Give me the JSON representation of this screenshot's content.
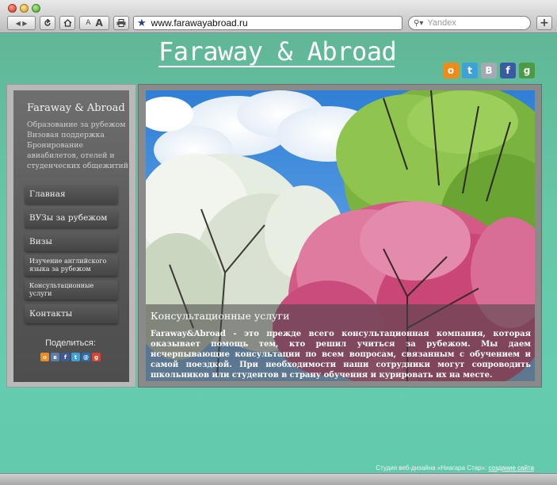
{
  "browser": {
    "url": "www.farawayabroad.ru",
    "search_placeholder": "Yandex",
    "back_forward": "◀ ▶",
    "reload_icon": "reload-icon",
    "home_icon": "home-icon",
    "font_small": "A",
    "font_large": "A",
    "add_tab": "+"
  },
  "site": {
    "title": "Faraway & Abroad"
  },
  "social_top": [
    {
      "icon": "odnoklassniki-icon",
      "glyph": "о",
      "color": "#f08a19"
    },
    {
      "icon": "twitter-icon",
      "glyph": "t",
      "color": "#3fa1d6"
    },
    {
      "icon": "vkontakte-icon",
      "glyph": "В",
      "color": "#a4a9b3"
    },
    {
      "icon": "facebook-icon",
      "glyph": "f",
      "color": "#3b5ba0"
    },
    {
      "icon": "google-icon",
      "glyph": "g",
      "color": "#4c9a45"
    }
  ],
  "sidebar": {
    "brand": "Faraway & Abroad",
    "desc_lines": [
      "Образование за рубежом",
      "Визовая поддержка",
      "Бронирование",
      "авиабилетов, отелей и",
      "студенческих общежитий"
    ],
    "nav": [
      {
        "label": "Главная"
      },
      {
        "label": "ВУЗы за рубежом"
      },
      {
        "label": "Визы"
      },
      {
        "label": "Изучение английского языка за рубежом"
      },
      {
        "label": "Консультационные услуги"
      },
      {
        "label": "Контакты"
      }
    ],
    "share_label": "Поделиться:"
  },
  "social_small": [
    {
      "icon": "odnoklassniki-icon",
      "glyph": "о",
      "color": "#f08a19"
    },
    {
      "icon": "vkontakte-icon",
      "glyph": "в",
      "color": "#5a7fa8"
    },
    {
      "icon": "facebook-icon",
      "glyph": "f",
      "color": "#3b5ba0"
    },
    {
      "icon": "twitter-icon",
      "glyph": "t",
      "color": "#3fa1d6"
    },
    {
      "icon": "mail-icon",
      "glyph": "@",
      "color": "#2a6db5"
    },
    {
      "icon": "google-plus-icon",
      "glyph": "g",
      "color": "#d6452f"
    }
  ],
  "main": {
    "caption_title": "Консультационные услуги",
    "caption_text": "Faraway&Abroad - это прежде всего консультационная компания, которая оказывает помощь тем, кто решил учиться за рубежом. Мы даем исчерпывающие консультации по всем вопросам, связанным с обучением и самой поездкой. При необходимости наши сотрудники могут сопроводить школьников или студентов в страну обучения и курировать их на месте."
  },
  "footer": {
    "text": "Студия веб-дизайна «Ниагара Стар»: ",
    "link": "создание сайта"
  },
  "colors": {
    "page_bg": "#63c4a5",
    "sidebar_dark": "#555555",
    "frame": "#8a8a8a"
  }
}
